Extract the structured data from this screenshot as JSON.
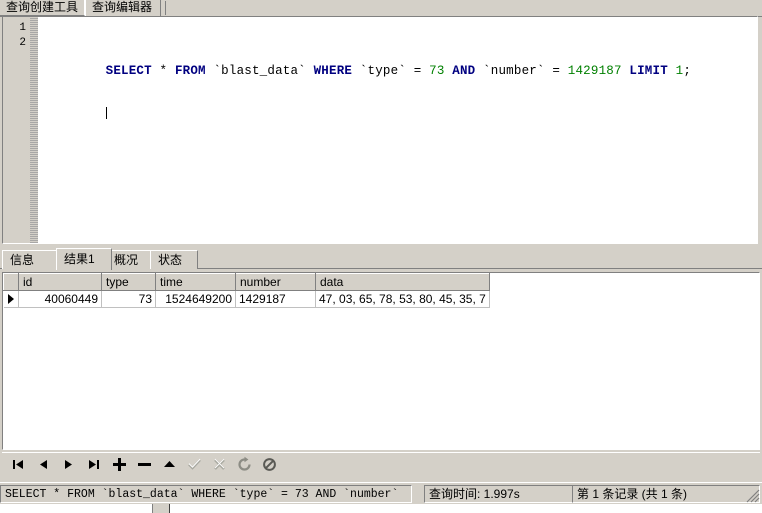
{
  "top_tabs": [
    {
      "label": "查询创建工具",
      "active": false
    },
    {
      "label": "查询编辑器",
      "active": true
    }
  ],
  "editor": {
    "line_numbers": [
      "1",
      "2"
    ],
    "sql_tokens": [
      {
        "text": "SELECT",
        "type": "keyword"
      },
      {
        "text": " ",
        "type": "plain"
      },
      {
        "text": "*",
        "type": "operator"
      },
      {
        "text": " ",
        "type": "plain"
      },
      {
        "text": "FROM",
        "type": "keyword"
      },
      {
        "text": " `blast_data` ",
        "type": "identifier"
      },
      {
        "text": "WHERE",
        "type": "keyword"
      },
      {
        "text": " `type` ",
        "type": "identifier"
      },
      {
        "text": "=",
        "type": "operator"
      },
      {
        "text": " ",
        "type": "plain"
      },
      {
        "text": "73",
        "type": "number"
      },
      {
        "text": " ",
        "type": "plain"
      },
      {
        "text": "AND",
        "type": "keyword"
      },
      {
        "text": " `number` ",
        "type": "identifier"
      },
      {
        "text": "=",
        "type": "operator"
      },
      {
        "text": " ",
        "type": "plain"
      },
      {
        "text": "1429187",
        "type": "number"
      },
      {
        "text": " ",
        "type": "plain"
      },
      {
        "text": "LIMIT",
        "type": "keyword"
      },
      {
        "text": " ",
        "type": "plain"
      },
      {
        "text": "1",
        "type": "number"
      },
      {
        "text": ";",
        "type": "operator"
      }
    ],
    "sql_plain": "SELECT * FROM `blast_data` WHERE `type` = 73 AND `number` = 1429187 LIMIT 1;",
    "colors": {
      "keyword": "#000080",
      "number": "#008000",
      "identifier": "#000000",
      "background": "#ffffff"
    }
  },
  "result_tabs": [
    {
      "label": "信息",
      "active": false
    },
    {
      "label": "结果1",
      "active": true
    },
    {
      "label": "概况",
      "active": false
    },
    {
      "label": "状态",
      "active": false
    }
  ],
  "grid": {
    "columns": [
      {
        "name": "id",
        "width": 83,
        "align": "num"
      },
      {
        "name": "type",
        "width": 54,
        "align": "num"
      },
      {
        "name": "time",
        "width": 80,
        "align": "num"
      },
      {
        "name": "number",
        "width": 80,
        "align": "txt"
      },
      {
        "name": "data",
        "width": 153,
        "align": "txt"
      }
    ],
    "rows": [
      {
        "selected": true,
        "cells": [
          "40060449",
          "73",
          "1524649200",
          "1429187",
          "47, 03, 65, 78, 53, 80, 45, 35, 7"
        ]
      }
    ]
  },
  "navigator": {
    "buttons": [
      {
        "name": "first-record-button",
        "icon": "first-icon",
        "enabled": true
      },
      {
        "name": "prev-record-button",
        "icon": "prev-icon",
        "enabled": true
      },
      {
        "name": "next-record-button",
        "icon": "next-icon",
        "enabled": true
      },
      {
        "name": "last-record-button",
        "icon": "last-icon",
        "enabled": true
      },
      {
        "name": "insert-record-button",
        "icon": "plus-icon",
        "enabled": true
      },
      {
        "name": "delete-record-button",
        "icon": "minus-icon",
        "enabled": true
      },
      {
        "name": "edit-record-button",
        "icon": "caret-up-icon",
        "enabled": true
      },
      {
        "name": "post-edit-button",
        "icon": "check-icon",
        "enabled": false
      },
      {
        "name": "cancel-edit-button",
        "icon": "cross-icon",
        "enabled": false
      },
      {
        "name": "refresh-button",
        "icon": "refresh-icon",
        "enabled": false
      },
      {
        "name": "stop-button",
        "icon": "stop-icon",
        "enabled": false
      }
    ]
  },
  "statusbar": {
    "sql_text": "SELECT * FROM `blast_data` WHERE `type` = 73 AND `number`",
    "query_time": "查询时间: 1.997s",
    "record_count": "第 1 条记录 (共 1 条)"
  }
}
